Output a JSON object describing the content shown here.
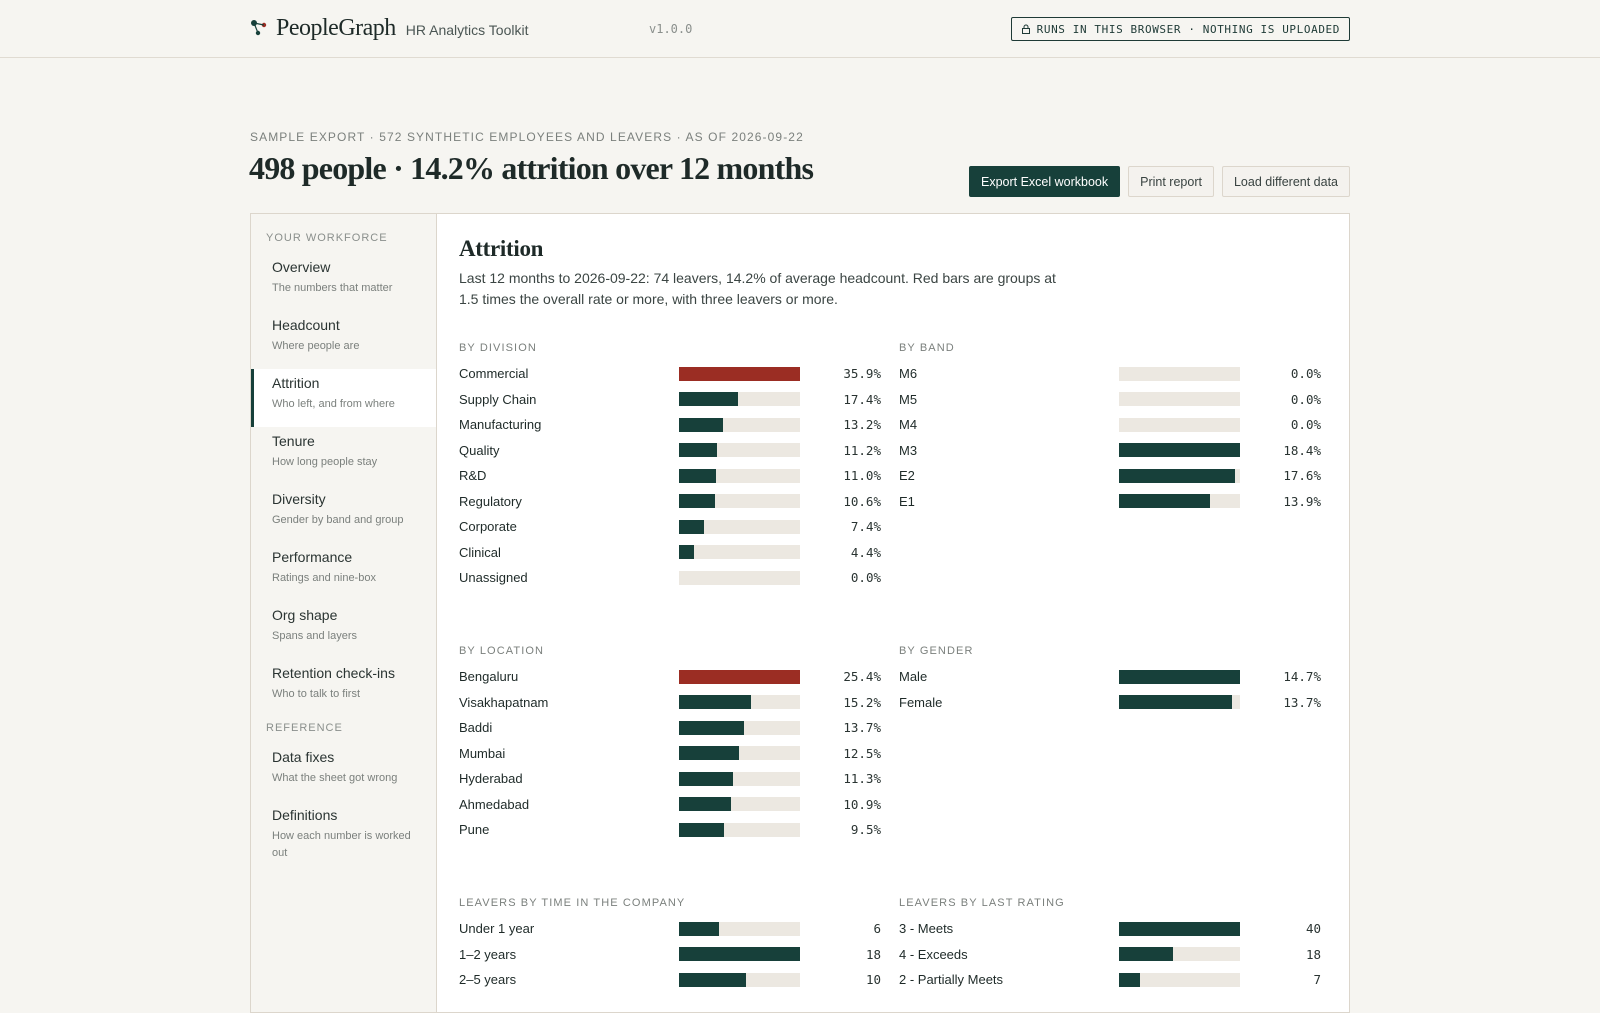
{
  "app": {
    "name": "PeopleGraph",
    "subtitle": "HR Analytics Toolkit",
    "version": "v1.0.0",
    "privacy_badge": "RUNS IN THIS BROWSER · NOTHING IS UPLOADED"
  },
  "header": {
    "eyebrow": "SAMPLE EXPORT · 572 SYNTHETIC EMPLOYEES AND LEAVERS · AS OF 2026-09-22",
    "title": "498 people · 14.2% attrition over 12 months",
    "buttons": {
      "export": "Export Excel workbook",
      "print": "Print report",
      "load": "Load different data"
    }
  },
  "sidebar": {
    "section_workforce": "YOUR WORKFORCE",
    "section_reference": "REFERENCE",
    "items": [
      {
        "label": "Overview",
        "desc": "The numbers that matter"
      },
      {
        "label": "Headcount",
        "desc": "Where people are"
      },
      {
        "label": "Attrition",
        "desc": "Who left, and from where"
      },
      {
        "label": "Tenure",
        "desc": "How long people stay"
      },
      {
        "label": "Diversity",
        "desc": "Gender by band and group"
      },
      {
        "label": "Performance",
        "desc": "Ratings and nine-box"
      },
      {
        "label": "Org shape",
        "desc": "Spans and layers"
      },
      {
        "label": "Retention check-ins",
        "desc": "Who to talk to first"
      }
    ],
    "reference_items": [
      {
        "label": "Data fixes",
        "desc": "What the sheet got wrong"
      },
      {
        "label": "Definitions",
        "desc": "How each number is worked out"
      }
    ],
    "active": "Attrition"
  },
  "main": {
    "title": "Attrition",
    "description": "Last 12 months to 2026-09-22: 74 leavers, 14.2% of average headcount. Red bars are groups at 1.5 times the overall rate or more, with three leavers or more."
  },
  "colors": {
    "bar": "#17403a",
    "bar_flagged": "#9b2d23",
    "track": "#ece8e1"
  },
  "chart_data": [
    {
      "type": "bar",
      "title": "BY DIVISION",
      "categories": [
        "Commercial",
        "Supply Chain",
        "Manufacturing",
        "Quality",
        "R&D",
        "Regulatory",
        "Corporate",
        "Clinical",
        "Unassigned"
      ],
      "values": [
        35.9,
        17.4,
        13.2,
        11.2,
        11.0,
        10.6,
        7.4,
        4.4,
        0.0
      ],
      "labels": [
        "35.9%",
        "17.4%",
        "13.2%",
        "11.2%",
        "11.0%",
        "10.6%",
        "7.4%",
        "4.4%",
        "0.0%"
      ],
      "flagged": [
        true,
        false,
        false,
        false,
        false,
        false,
        false,
        false,
        false
      ]
    },
    {
      "type": "bar",
      "title": "BY BAND",
      "categories": [
        "M6",
        "M5",
        "M4",
        "M3",
        "E2",
        "E1"
      ],
      "values": [
        0.0,
        0.0,
        0.0,
        18.4,
        17.6,
        13.9
      ],
      "labels": [
        "0.0%",
        "0.0%",
        "0.0%",
        "18.4%",
        "17.6%",
        "13.9%"
      ],
      "flagged": [
        false,
        false,
        false,
        false,
        false,
        false
      ]
    },
    {
      "type": "bar",
      "title": "BY LOCATION",
      "categories": [
        "Bengaluru",
        "Visakhapatnam",
        "Baddi",
        "Mumbai",
        "Hyderabad",
        "Ahmedabad",
        "Pune"
      ],
      "values": [
        25.4,
        15.2,
        13.7,
        12.5,
        11.3,
        10.9,
        9.5
      ],
      "labels": [
        "25.4%",
        "15.2%",
        "13.7%",
        "12.5%",
        "11.3%",
        "10.9%",
        "9.5%"
      ],
      "flagged": [
        true,
        false,
        false,
        false,
        false,
        false,
        false
      ]
    },
    {
      "type": "bar",
      "title": "BY GENDER",
      "categories": [
        "Male",
        "Female"
      ],
      "values": [
        14.7,
        13.7
      ],
      "labels": [
        "14.7%",
        "13.7%"
      ],
      "flagged": [
        false,
        false
      ]
    },
    {
      "type": "bar",
      "title": "LEAVERS BY TIME IN THE COMPANY",
      "categories": [
        "Under 1 year",
        "1–2 years",
        "2–5 years"
      ],
      "values": [
        6,
        18,
        10
      ],
      "labels": [
        "6",
        "18",
        "10"
      ],
      "flagged": [
        false,
        false,
        false
      ]
    },
    {
      "type": "bar",
      "title": "LEAVERS BY LAST RATING",
      "categories": [
        "3 - Meets",
        "4 - Exceeds",
        "2 - Partially Meets"
      ],
      "values": [
        40,
        18,
        7
      ],
      "labels": [
        "40",
        "18",
        "7"
      ],
      "flagged": [
        false,
        false,
        false
      ]
    }
  ]
}
